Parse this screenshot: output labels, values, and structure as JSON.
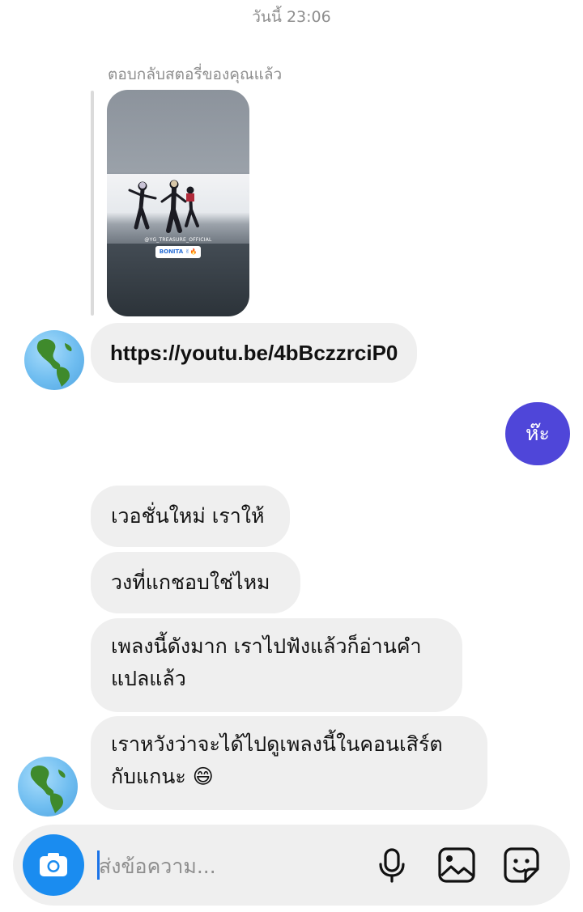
{
  "header": {
    "timestamp": "วันนี้ 23:06"
  },
  "story_reply": {
    "label": "ตอบกลับสตอรี่ของคุณแล้ว",
    "thumbnail": {
      "handle": "@YG_TREASURE_OFFICIAL",
      "sticker": "BONITA ✌🔥"
    }
  },
  "messages": {
    "link": "https://youtu.be/4bBczzrciP0",
    "sent": "ห๊ะ",
    "received": [
      "เวอชั่นใหม่ เราให้",
      "วงที่แกชอบใช่ไหม",
      "เพลงนี้ดังมาก เราไปฟังแล้วก็อ่านคำแปลแล้ว",
      "เราหวังว่าจะได้ไปดูเพลงนี้ในคอนเสิร์ตกับแกนะ 😄"
    ]
  },
  "composer": {
    "placeholder": "ส่งข้อความ..."
  },
  "icons": {
    "avatar": "globe-americas-icon",
    "camera": "camera-icon",
    "mic": "microphone-icon",
    "gallery": "image-icon",
    "sticker": "sticker-icon"
  },
  "colors": {
    "sent_bubble": "#4f46d9",
    "received_bubble": "#efefef",
    "camera_button": "#1a8cf0",
    "secondary_text": "#8e8e8e"
  }
}
